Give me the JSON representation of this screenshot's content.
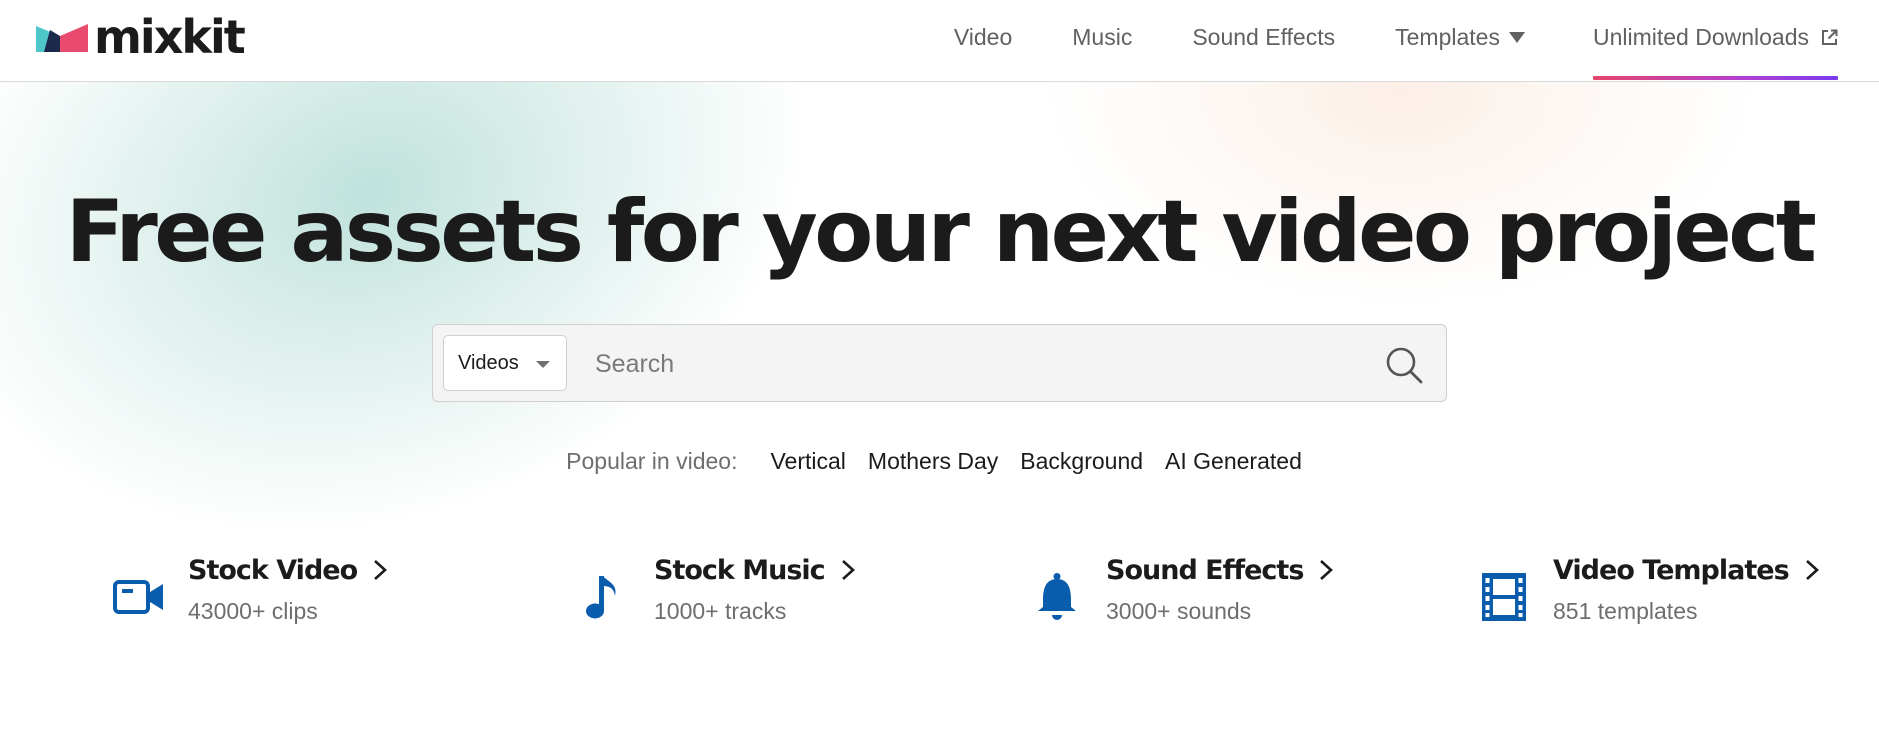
{
  "brand": {
    "name": "mixkit",
    "colors": {
      "teal": "#4fc7c9",
      "pink": "#e94b6e",
      "navy": "#1b2a4a",
      "accent_blue": "#0a5cad"
    }
  },
  "nav": {
    "items": [
      {
        "label": "Video"
      },
      {
        "label": "Music"
      },
      {
        "label": "Sound Effects"
      },
      {
        "label": "Templates",
        "icon": "caret-down-icon"
      },
      {
        "label": "Unlimited Downloads",
        "icon": "external-link-icon"
      }
    ]
  },
  "hero": {
    "headline": "Free assets for your next video project"
  },
  "search": {
    "category_selected": "Videos",
    "placeholder": "Search",
    "value": ""
  },
  "popular": {
    "label": "Popular in video:",
    "tags": [
      "Vertical",
      "Mothers Day",
      "Background",
      "AI Generated"
    ]
  },
  "categories": [
    {
      "title": "Stock Video",
      "subtitle": "43000+ clips",
      "icon": "video-camera-icon"
    },
    {
      "title": "Stock Music",
      "subtitle": "1000+ tracks",
      "icon": "music-note-icon"
    },
    {
      "title": "Sound Effects",
      "subtitle": "3000+ sounds",
      "icon": "bell-icon"
    },
    {
      "title": "Video Templates",
      "subtitle": "851 templates",
      "icon": "film-strip-icon"
    }
  ]
}
